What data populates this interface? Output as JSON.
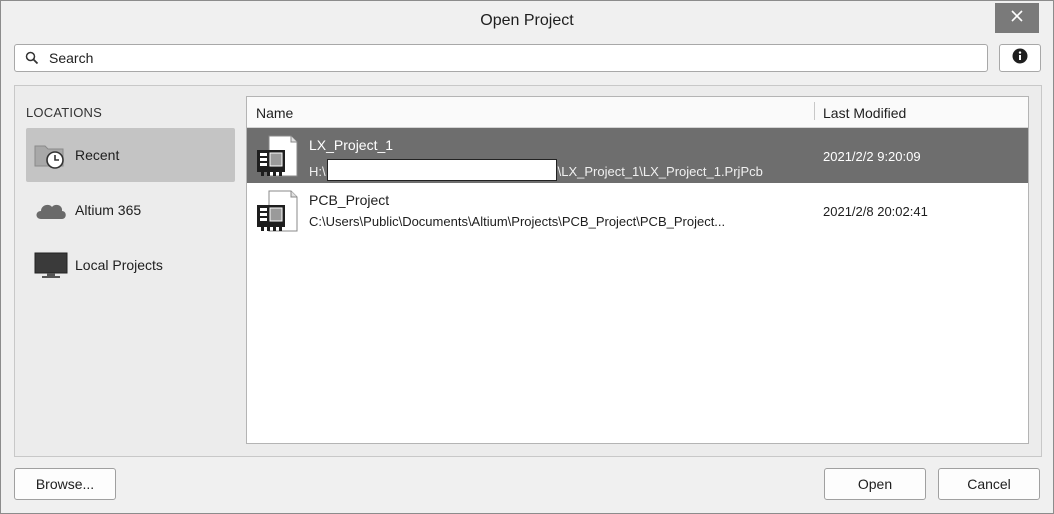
{
  "window": {
    "title": "Open Project",
    "close_glyph": "✕"
  },
  "search": {
    "placeholder": "Search",
    "value": ""
  },
  "sidebar": {
    "header": "LOCATIONS",
    "items": [
      {
        "label": "Recent",
        "icon": "recent-folder-clock-icon",
        "selected": true
      },
      {
        "label": "Altium 365",
        "icon": "cloud-icon",
        "selected": false
      },
      {
        "label": "Local Projects",
        "icon": "monitor-icon",
        "selected": false
      }
    ]
  },
  "file_list": {
    "columns": [
      "Name",
      "Last Modified"
    ],
    "rows": [
      {
        "name": "LX_Project_1",
        "path_prefix": "H:\\",
        "path_suffix": "\\LX_Project_1\\LX_Project_1.PrjPcb",
        "modified": "2021/2/2 9:20:09",
        "selected": true
      },
      {
        "name": "PCB_Project",
        "path": "C:\\Users\\Public\\Documents\\Altium\\Projects\\PCB_Project\\PCB_Project...",
        "modified": "2021/2/8 20:02:41",
        "selected": false
      }
    ]
  },
  "buttons": {
    "browse": "Browse...",
    "open": "Open",
    "cancel": "Cancel"
  },
  "colors": {
    "selected_row": "#6e6e6e",
    "selected_location": "#c4c4c4",
    "close_button": "#7a7a7a"
  }
}
